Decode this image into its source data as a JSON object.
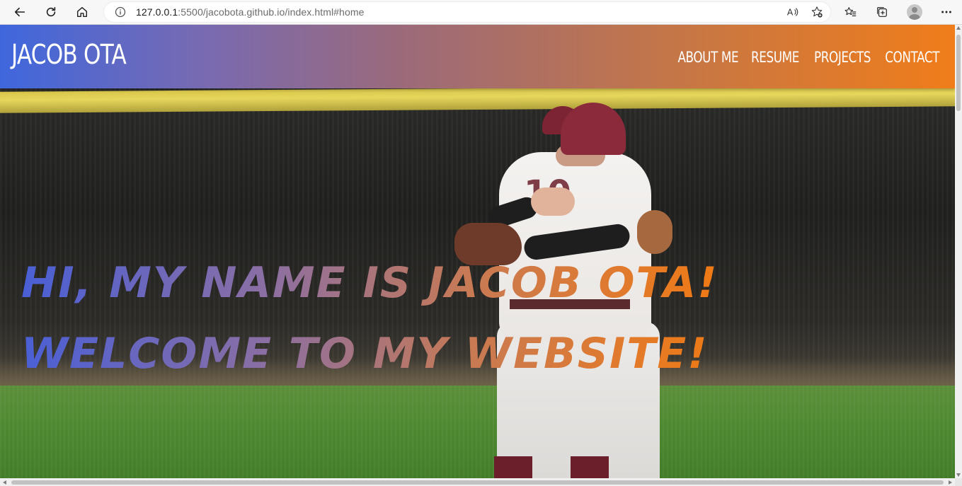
{
  "browser": {
    "url_host": "127.0.0.1",
    "url_rest": ":5500/jacobota.github.io/index.html#home",
    "icons": {
      "back": "back-arrow-icon",
      "refresh": "refresh-icon",
      "home": "home-icon",
      "site_info": "info-icon",
      "read_aloud": "read-aloud-icon",
      "add_favorite": "add-favorite-icon",
      "favorites": "favorites-icon",
      "collections": "collections-icon",
      "profile": "profile-avatar",
      "more": "more-menu-icon"
    }
  },
  "site": {
    "brand": "JACOB OTA",
    "nav": [
      {
        "label": "ABOUT ME"
      },
      {
        "label": "RESUME"
      },
      {
        "label": "PROJECTS"
      },
      {
        "label": "CONTACT"
      }
    ],
    "hero": {
      "line1": "HI, MY NAME IS JACOB OTA!",
      "line2": "WELCOME TO MY WEBSITE!",
      "jersey_number": "10"
    },
    "colors": {
      "gradient_start": "#3f67dd",
      "gradient_end": "#f07d1a"
    }
  }
}
